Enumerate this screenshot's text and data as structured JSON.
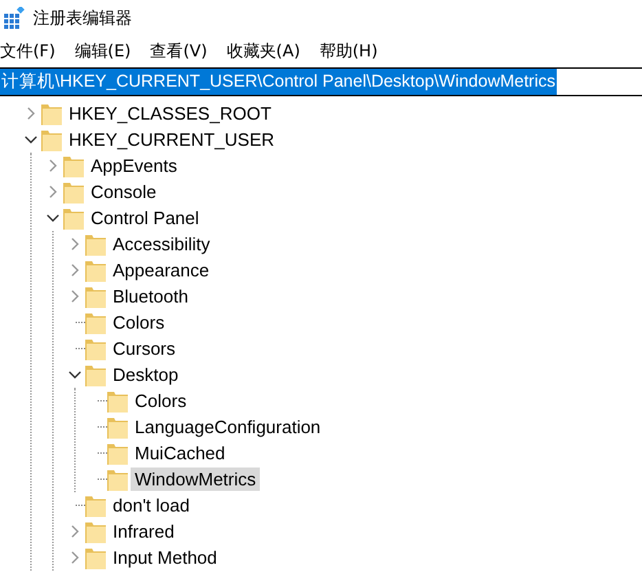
{
  "window": {
    "title": "注册表编辑器"
  },
  "menu": [
    {
      "label": "文件(F)"
    },
    {
      "label": "编辑(E)"
    },
    {
      "label": "查看(V)"
    },
    {
      "label": "收藏夹(A)"
    },
    {
      "label": "帮助(H)"
    }
  ],
  "address_bar": {
    "value": "计算机\\HKEY_CURRENT_USER\\Control Panel\\Desktop\\WindowMetrics",
    "text_selected": true
  },
  "tree": [
    {
      "label": "HKEY_CLASSES_ROOT",
      "expanded": false,
      "selected": false
    },
    {
      "label": "HKEY_CURRENT_USER",
      "expanded": true,
      "selected": false,
      "children": [
        {
          "label": "AppEvents",
          "expanded": false,
          "selected": false
        },
        {
          "label": "Console",
          "expanded": false,
          "selected": false
        },
        {
          "label": "Control Panel",
          "expanded": true,
          "selected": false,
          "children": [
            {
              "label": "Accessibility",
              "expanded": false,
              "selected": false
            },
            {
              "label": "Appearance",
              "expanded": false,
              "selected": false
            },
            {
              "label": "Bluetooth",
              "expanded": false,
              "selected": false
            },
            {
              "label": "Colors",
              "selected": false
            },
            {
              "label": "Cursors",
              "selected": false
            },
            {
              "label": "Desktop",
              "expanded": true,
              "selected": false,
              "children": [
                {
                  "label": "Colors",
                  "selected": false
                },
                {
                  "label": "LanguageConfiguration",
                  "selected": false
                },
                {
                  "label": "MuiCached",
                  "selected": false
                },
                {
                  "label": "WindowMetrics",
                  "selected": true
                }
              ]
            },
            {
              "label": "don't load",
              "selected": false
            },
            {
              "label": "Infrared",
              "expanded": false,
              "selected": false
            },
            {
              "label": "Input Method",
              "expanded": false,
              "selected": false
            }
          ]
        }
      ]
    }
  ]
}
